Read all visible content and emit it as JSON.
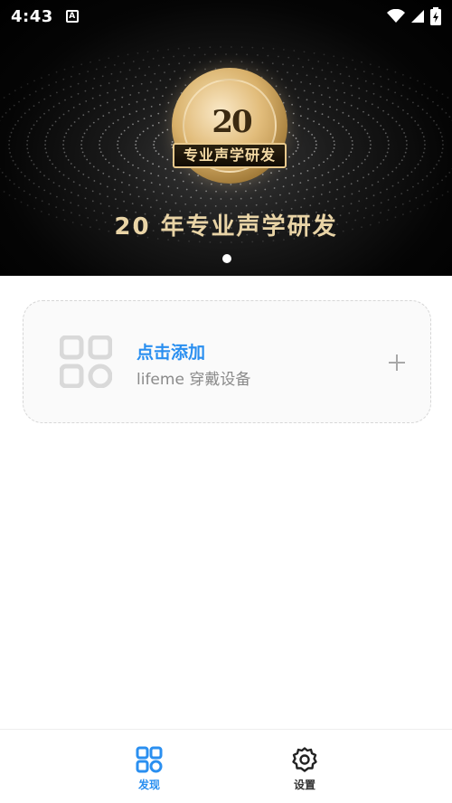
{
  "status_bar": {
    "time": "4:43",
    "icons": [
      "a-notification-icon",
      "wifi-icon",
      "signal-icon",
      "battery-icon"
    ]
  },
  "banner": {
    "badge_number": "20",
    "badge_ribbon": "专业声学研发",
    "title": "20 年专业声学研发",
    "page_count": 1,
    "active_page": 0
  },
  "add_card": {
    "title": "点击添加",
    "subtitle": "lifeme 穿戴设备",
    "icon": "grid-icon",
    "action_icon": "plus-icon"
  },
  "bottom_nav": {
    "items": [
      {
        "label": "发现",
        "icon": "grid-icon",
        "active": true
      },
      {
        "label": "设置",
        "icon": "gear-icon",
        "active": false
      }
    ]
  },
  "colors": {
    "accent": "#2a8ff0",
    "gold": "#e9d4a6",
    "subtle": "#8a8a8a"
  }
}
